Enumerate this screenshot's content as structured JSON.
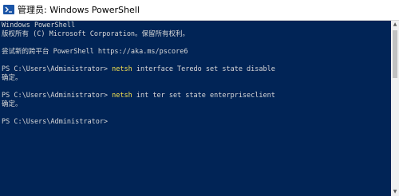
{
  "window": {
    "title": "管理员: Windows PowerShell",
    "icon": "powershell-icon"
  },
  "console": {
    "lines": [
      {
        "text": "Windows PowerShell"
      },
      {
        "text": "版权所有 (C) Microsoft Corporation。保留所有权利。"
      },
      {
        "text": ""
      },
      {
        "text": "尝试新的跨平台 PowerShell https://aka.ms/pscore6"
      },
      {
        "text": ""
      },
      {
        "prompt": "PS C:\\Users\\Administrator> ",
        "command": "netsh",
        "args": " interface Teredo set state disable"
      },
      {
        "text": "确定。"
      },
      {
        "text": ""
      },
      {
        "prompt": "PS C:\\Users\\Administrator> ",
        "command": "netsh",
        "args": " int ter set state enterpriseclient"
      },
      {
        "text": "确定。"
      },
      {
        "text": ""
      },
      {
        "text": "PS C:\\Users\\Administrator>"
      }
    ]
  },
  "colors": {
    "background": "#012456",
    "text": "#d8d8d8",
    "command": "#f2e14f"
  }
}
